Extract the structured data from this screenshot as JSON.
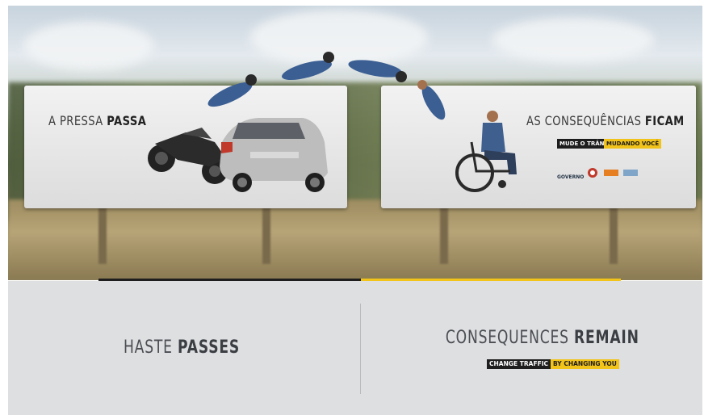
{
  "billboards": {
    "left_heading_regular": "A PRESSA ",
    "left_heading_bold": "PASSA",
    "right_heading_regular": "AS CONSEQUÊNCIAS ",
    "right_heading_bold": "FICAM",
    "right_tag_dark": "MUDE O TRÂNSITO",
    "right_tag_yellow": "MUDANDO VOCÊ",
    "logos": [
      "GOVERNO",
      "",
      "",
      ""
    ]
  },
  "captions": {
    "left_regular": "HASTE ",
    "left_bold": "PASSES",
    "right_regular": "CONSEQUENCES ",
    "right_bold": "REMAIN",
    "slogan_dark": "CHANGE TRAFFIC",
    "slogan_yellow": "BY CHANGING YOU"
  },
  "colors": {
    "accent_yellow": "#f2c318",
    "dark": "#1e1e1e",
    "panel": "#dedfe1"
  }
}
